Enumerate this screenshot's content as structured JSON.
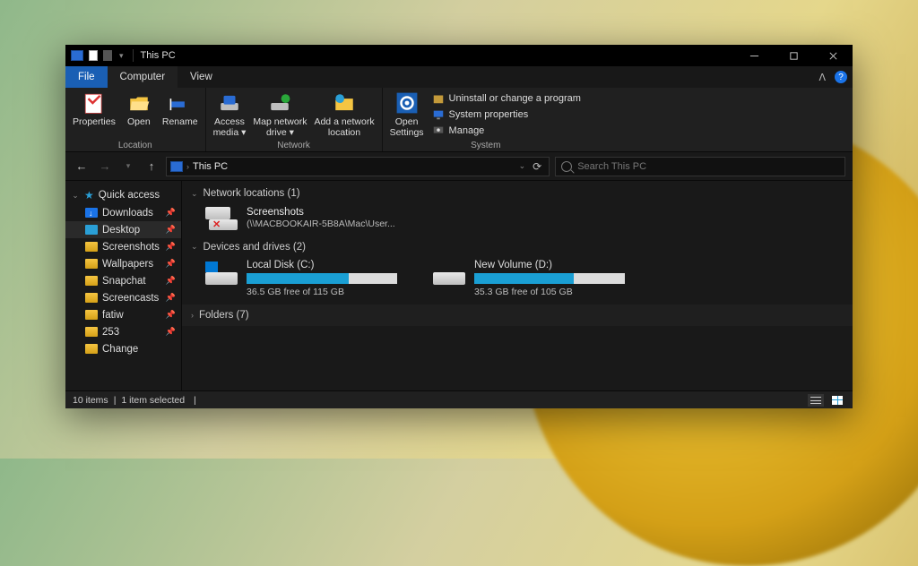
{
  "title": "This PC",
  "menu": {
    "file": "File",
    "computer": "Computer",
    "view": "View"
  },
  "ribbon": {
    "location": {
      "label": "Location",
      "properties": "Properties",
      "open": "Open",
      "rename": "Rename"
    },
    "network": {
      "label": "Network",
      "access": "Access\nmedia ▾",
      "map": "Map network\ndrive ▾",
      "add": "Add a network\nlocation"
    },
    "system": {
      "label": "System",
      "open_settings": "Open\nSettings",
      "uninstall": "Uninstall or change a program",
      "props": "System properties",
      "manage": "Manage"
    }
  },
  "address": {
    "crumb": "This PC"
  },
  "search": {
    "placeholder": "Search This PC"
  },
  "sidebar": {
    "quick": "Quick access",
    "items": [
      {
        "label": "Downloads",
        "icon": "download"
      },
      {
        "label": "Desktop",
        "icon": "desktop"
      },
      {
        "label": "Screenshots",
        "icon": "folder"
      },
      {
        "label": "Wallpapers",
        "icon": "folder"
      },
      {
        "label": "Snapchat",
        "icon": "folder"
      },
      {
        "label": "Screencasts",
        "icon": "folder"
      },
      {
        "label": "fatiw",
        "icon": "folder"
      },
      {
        "label": "253",
        "icon": "folder"
      },
      {
        "label": "Change",
        "icon": "folder"
      }
    ]
  },
  "sections": {
    "netloc": {
      "title": "Network locations (1)",
      "name": "Screenshots",
      "path": "(\\\\MACBOOKAIR-5B8A\\Mac\\User..."
    },
    "drives_title": "Devices and drives (2)",
    "drives": [
      {
        "name": "Local Disk (C:)",
        "free": "36.5 GB free of 115 GB",
        "fill": 68
      },
      {
        "name": "New Volume (D:)",
        "free": "35.3 GB free of 105 GB",
        "fill": 66
      }
    ],
    "folders": "Folders (7)"
  },
  "status": {
    "items": "10 items",
    "selected": "1 item selected"
  }
}
